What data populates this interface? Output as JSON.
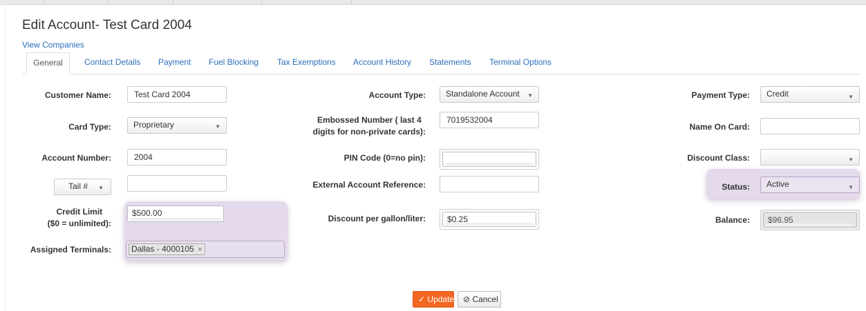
{
  "page": {
    "title": "Edit Account- Test Card 2004",
    "view_companies_link": "View Companies"
  },
  "tabs": [
    {
      "label": "General",
      "active": true
    },
    {
      "label": "Contact Details"
    },
    {
      "label": "Payment"
    },
    {
      "label": "Fuel Blocking"
    },
    {
      "label": "Tax Exemptions"
    },
    {
      "label": "Account History"
    },
    {
      "label": "Statements"
    },
    {
      "label": "Terminal Options"
    }
  ],
  "form": {
    "customer_name": {
      "label": "Customer Name:",
      "value": "Test Card 2004"
    },
    "card_type": {
      "label": "Card Type:",
      "value": "Proprietary"
    },
    "account_number": {
      "label": "Account Number:",
      "value": "2004"
    },
    "tail": {
      "label": "Tail #",
      "value": ""
    },
    "credit_limit": {
      "label_line1": "Credit Limit",
      "label_line2": "($0 = unlimited):",
      "value": "$500.00"
    },
    "assigned_terminals": {
      "label": "Assigned Terminals:",
      "tags": [
        "Dallas - 4000105"
      ],
      "remove_glyph": "×"
    },
    "account_type": {
      "label": "Account Type:",
      "value": "Standalone Account"
    },
    "embossed_number": {
      "label_line1": "Embossed Number ( last 4",
      "label_line2": "digits for non-private cards):",
      "value": "7019532004"
    },
    "pin_code": {
      "label": "PIN Code (0=no pin):",
      "value": ""
    },
    "external_account_reference": {
      "label": "External Account Reference:",
      "value": ""
    },
    "discount_per_gallon": {
      "label": "Discount per gallon/liter:",
      "value": "$0.25"
    },
    "payment_type": {
      "label": "Payment Type:",
      "value": "Credit"
    },
    "name_on_card": {
      "label": "Name On Card:",
      "value": ""
    },
    "discount_class": {
      "label": "Discount Class:",
      "value": ""
    },
    "status": {
      "label": "Status:",
      "value": "Active"
    },
    "balance": {
      "label": "Balance:",
      "value": "$96.95"
    }
  },
  "buttons": {
    "update_label": "Update",
    "update_icon": "✓",
    "cancel_label": "Cancel",
    "cancel_icon": "⊘"
  },
  "icons": {
    "caret": "▼",
    "check": "check-icon",
    "cancel": "cancel-circle-icon"
  },
  "colors": {
    "link": "#2a6ebb",
    "update_button": "#f26722",
    "highlight": "#bea8d0"
  }
}
